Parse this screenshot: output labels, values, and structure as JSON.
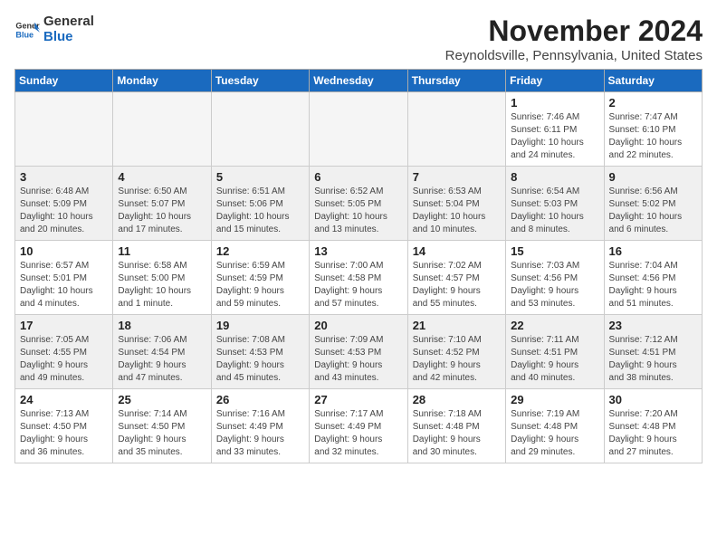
{
  "header": {
    "logo_general": "General",
    "logo_blue": "Blue",
    "month_title": "November 2024",
    "location": "Reynoldsville, Pennsylvania, United States"
  },
  "weekdays": [
    "Sunday",
    "Monday",
    "Tuesday",
    "Wednesday",
    "Thursday",
    "Friday",
    "Saturday"
  ],
  "weeks": [
    {
      "shaded": false,
      "days": [
        {
          "day": "",
          "info": ""
        },
        {
          "day": "",
          "info": ""
        },
        {
          "day": "",
          "info": ""
        },
        {
          "day": "",
          "info": ""
        },
        {
          "day": "",
          "info": ""
        },
        {
          "day": "1",
          "info": "Sunrise: 7:46 AM\nSunset: 6:11 PM\nDaylight: 10 hours\nand 24 minutes."
        },
        {
          "day": "2",
          "info": "Sunrise: 7:47 AM\nSunset: 6:10 PM\nDaylight: 10 hours\nand 22 minutes."
        }
      ]
    },
    {
      "shaded": true,
      "days": [
        {
          "day": "3",
          "info": "Sunrise: 6:48 AM\nSunset: 5:09 PM\nDaylight: 10 hours\nand 20 minutes."
        },
        {
          "day": "4",
          "info": "Sunrise: 6:50 AM\nSunset: 5:07 PM\nDaylight: 10 hours\nand 17 minutes."
        },
        {
          "day": "5",
          "info": "Sunrise: 6:51 AM\nSunset: 5:06 PM\nDaylight: 10 hours\nand 15 minutes."
        },
        {
          "day": "6",
          "info": "Sunrise: 6:52 AM\nSunset: 5:05 PM\nDaylight: 10 hours\nand 13 minutes."
        },
        {
          "day": "7",
          "info": "Sunrise: 6:53 AM\nSunset: 5:04 PM\nDaylight: 10 hours\nand 10 minutes."
        },
        {
          "day": "8",
          "info": "Sunrise: 6:54 AM\nSunset: 5:03 PM\nDaylight: 10 hours\nand 8 minutes."
        },
        {
          "day": "9",
          "info": "Sunrise: 6:56 AM\nSunset: 5:02 PM\nDaylight: 10 hours\nand 6 minutes."
        }
      ]
    },
    {
      "shaded": false,
      "days": [
        {
          "day": "10",
          "info": "Sunrise: 6:57 AM\nSunset: 5:01 PM\nDaylight: 10 hours\nand 4 minutes."
        },
        {
          "day": "11",
          "info": "Sunrise: 6:58 AM\nSunset: 5:00 PM\nDaylight: 10 hours\nand 1 minute."
        },
        {
          "day": "12",
          "info": "Sunrise: 6:59 AM\nSunset: 4:59 PM\nDaylight: 9 hours\nand 59 minutes."
        },
        {
          "day": "13",
          "info": "Sunrise: 7:00 AM\nSunset: 4:58 PM\nDaylight: 9 hours\nand 57 minutes."
        },
        {
          "day": "14",
          "info": "Sunrise: 7:02 AM\nSunset: 4:57 PM\nDaylight: 9 hours\nand 55 minutes."
        },
        {
          "day": "15",
          "info": "Sunrise: 7:03 AM\nSunset: 4:56 PM\nDaylight: 9 hours\nand 53 minutes."
        },
        {
          "day": "16",
          "info": "Sunrise: 7:04 AM\nSunset: 4:56 PM\nDaylight: 9 hours\nand 51 minutes."
        }
      ]
    },
    {
      "shaded": true,
      "days": [
        {
          "day": "17",
          "info": "Sunrise: 7:05 AM\nSunset: 4:55 PM\nDaylight: 9 hours\nand 49 minutes."
        },
        {
          "day": "18",
          "info": "Sunrise: 7:06 AM\nSunset: 4:54 PM\nDaylight: 9 hours\nand 47 minutes."
        },
        {
          "day": "19",
          "info": "Sunrise: 7:08 AM\nSunset: 4:53 PM\nDaylight: 9 hours\nand 45 minutes."
        },
        {
          "day": "20",
          "info": "Sunrise: 7:09 AM\nSunset: 4:53 PM\nDaylight: 9 hours\nand 43 minutes."
        },
        {
          "day": "21",
          "info": "Sunrise: 7:10 AM\nSunset: 4:52 PM\nDaylight: 9 hours\nand 42 minutes."
        },
        {
          "day": "22",
          "info": "Sunrise: 7:11 AM\nSunset: 4:51 PM\nDaylight: 9 hours\nand 40 minutes."
        },
        {
          "day": "23",
          "info": "Sunrise: 7:12 AM\nSunset: 4:51 PM\nDaylight: 9 hours\nand 38 minutes."
        }
      ]
    },
    {
      "shaded": false,
      "days": [
        {
          "day": "24",
          "info": "Sunrise: 7:13 AM\nSunset: 4:50 PM\nDaylight: 9 hours\nand 36 minutes."
        },
        {
          "day": "25",
          "info": "Sunrise: 7:14 AM\nSunset: 4:50 PM\nDaylight: 9 hours\nand 35 minutes."
        },
        {
          "day": "26",
          "info": "Sunrise: 7:16 AM\nSunset: 4:49 PM\nDaylight: 9 hours\nand 33 minutes."
        },
        {
          "day": "27",
          "info": "Sunrise: 7:17 AM\nSunset: 4:49 PM\nDaylight: 9 hours\nand 32 minutes."
        },
        {
          "day": "28",
          "info": "Sunrise: 7:18 AM\nSunset: 4:48 PM\nDaylight: 9 hours\nand 30 minutes."
        },
        {
          "day": "29",
          "info": "Sunrise: 7:19 AM\nSunset: 4:48 PM\nDaylight: 9 hours\nand 29 minutes."
        },
        {
          "day": "30",
          "info": "Sunrise: 7:20 AM\nSunset: 4:48 PM\nDaylight: 9 hours\nand 27 minutes."
        }
      ]
    }
  ]
}
